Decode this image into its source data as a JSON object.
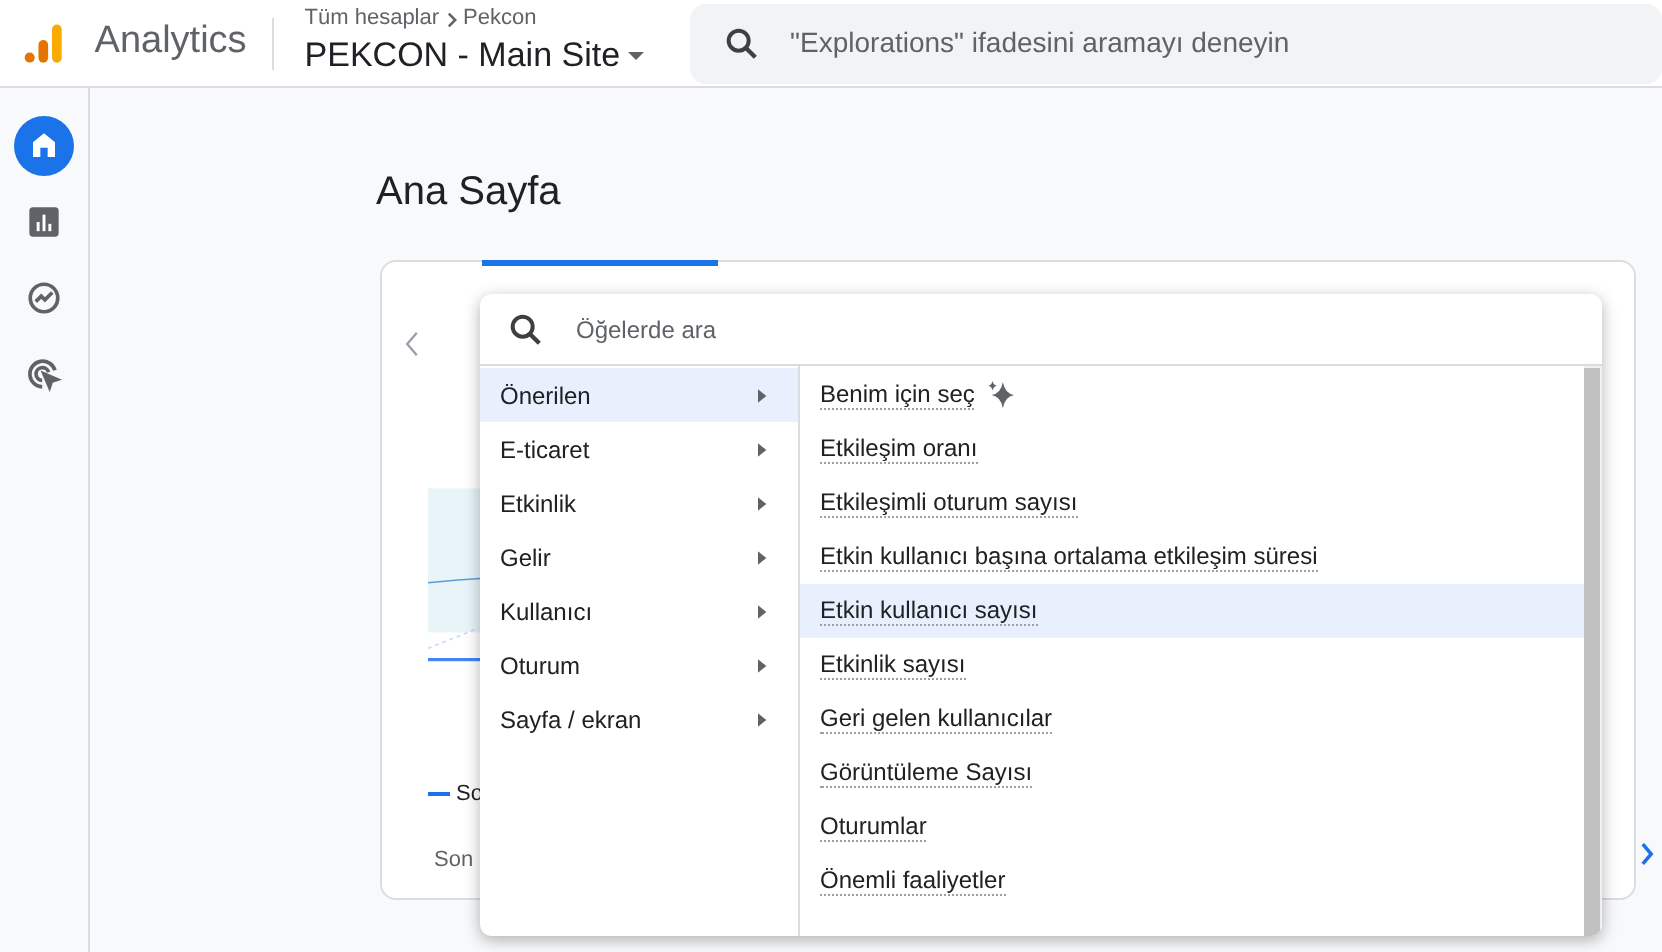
{
  "header": {
    "product": "Analytics",
    "breadcrumb": [
      "Tüm hesaplar",
      "Pekcon"
    ],
    "property": "PEKCON - Main Site",
    "search": {
      "placeholder": "\"Explorations\" ifadesini aramayı deneyin"
    }
  },
  "nav": [
    {
      "selected": true
    },
    {
      "selected": false
    },
    {
      "selected": false
    },
    {
      "selected": false
    }
  ],
  "page_title": "Ana Sayfa",
  "card": {
    "legend": "So",
    "footer": "Son"
  },
  "menu": {
    "search": {
      "placeholder": "Öğelerde ara"
    },
    "categories": [
      {
        "label": "Önerilen",
        "selected": true
      },
      {
        "label": "E-ticaret",
        "selected": false
      },
      {
        "label": "Etkinlik",
        "selected": false
      },
      {
        "label": "Gelir",
        "selected": false
      },
      {
        "label": "Kullanıcı",
        "selected": false
      },
      {
        "label": "Oturum",
        "selected": false
      },
      {
        "label": "Sayfa / ekran",
        "selected": false
      }
    ],
    "metrics": [
      {
        "label": "Benim için seç",
        "kind": "ai",
        "selected": false
      },
      {
        "label": "Etkileşim oranı",
        "kind": "metric",
        "selected": false
      },
      {
        "label": "Etkileşimli oturum sayısı",
        "kind": "metric",
        "selected": false
      },
      {
        "label": "Etkin kullanıcı başına ortalama etkileşim süresi",
        "kind": "metric",
        "selected": false
      },
      {
        "label": "Etkin kullanıcı sayısı",
        "kind": "metric",
        "selected": true
      },
      {
        "label": "Etkinlik sayısı",
        "kind": "metric",
        "selected": false
      },
      {
        "label": "Geri gelen kullanıcılar",
        "kind": "metric",
        "selected": false
      },
      {
        "label": "Görüntüleme Sayısı",
        "kind": "metric",
        "selected": false
      },
      {
        "label": "Oturumlar",
        "kind": "metric",
        "selected": false
      },
      {
        "label": "Önemli faaliyetler",
        "kind": "metric",
        "selected": false
      }
    ]
  }
}
